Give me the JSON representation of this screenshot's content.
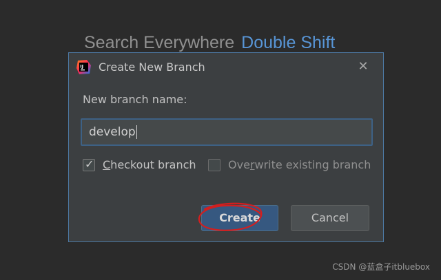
{
  "background_hint": {
    "text": "Search Everywhere",
    "shortcut": "Double Shift"
  },
  "dialog": {
    "title": "Create New Branch",
    "app_icon": "intellij-idea-icon",
    "close_icon": "close-icon",
    "field_label": "New branch name:",
    "branch_name_value": "develop",
    "checkout": {
      "label_prefix": "",
      "label_mnemonic": "C",
      "label_rest": "heckout branch",
      "checked": true
    },
    "overwrite": {
      "label_prefix": "Ove",
      "label_mnemonic": "r",
      "label_rest": "write existing branch",
      "checked": false,
      "enabled": false
    },
    "create_button": "Create",
    "cancel_button": "Cancel"
  },
  "colors": {
    "background": "#2b2b2b",
    "dialog_bg": "#3c3f41",
    "accent": "#5895d6",
    "primary_button": "#365880",
    "annotation": "#d21f1f"
  },
  "watermark": "CSDN @蓝盒子itbluebox"
}
